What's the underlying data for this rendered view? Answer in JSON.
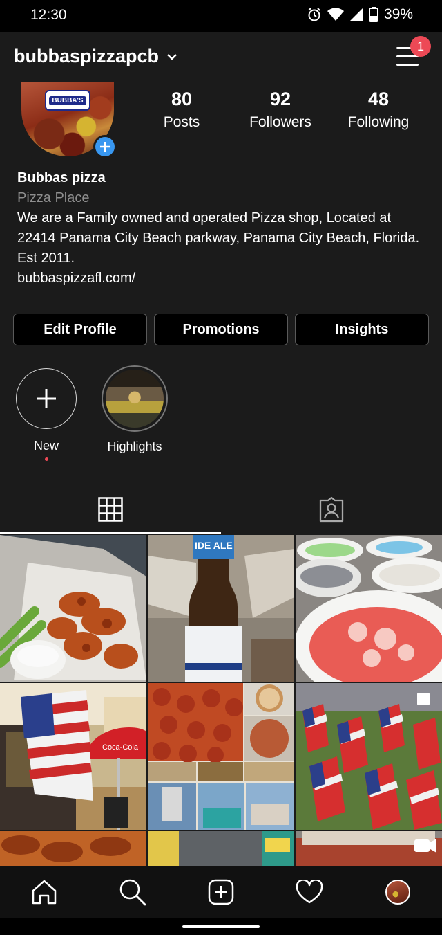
{
  "status_bar": {
    "time": "12:30",
    "battery": "39%"
  },
  "header": {
    "username": "bubbaspizzapcb",
    "notification_count": "1"
  },
  "profile": {
    "avatar_logo_text": "BUBBA'S",
    "stats": [
      {
        "value": "80",
        "label": "Posts"
      },
      {
        "value": "92",
        "label": "Followers"
      },
      {
        "value": "48",
        "label": "Following"
      }
    ],
    "bio": {
      "name": "Bubbas pizza",
      "category": "Pizza Place",
      "description": "We are a Family owned and operated Pizza shop, Located at 22414 Panama City Beach parkway, Panama City Beach, Florida. Est 2011.",
      "link": "bubbaspizzafl.com/"
    }
  },
  "buttons": {
    "edit_profile": "Edit Profile",
    "promotions": "Promotions",
    "insights": "Insights"
  },
  "stories": [
    {
      "label": "New",
      "icon": "plus-icon"
    },
    {
      "label": "Highlights"
    }
  ],
  "tabs": [
    {
      "icon": "grid-icon",
      "active": true
    },
    {
      "icon": "tagged-icon",
      "active": false
    }
  ],
  "posts": [
    {
      "subject": "buffalo wings with celery and ranch"
    },
    {
      "subject": "beer bottle in koozie",
      "label_text": "IDE ALE"
    },
    {
      "subject": "bowls of shaved ice"
    },
    {
      "subject": "storefront with american flag",
      "label_text": "Coca-Cola"
    },
    {
      "subject": "pizza collage"
    },
    {
      "subject": "field of american flags"
    },
    {
      "subject": "wings"
    },
    {
      "subject": "beer cans"
    },
    {
      "subject": "video post"
    }
  ],
  "bottom_nav": [
    {
      "icon": "home-icon"
    },
    {
      "icon": "search-icon"
    },
    {
      "icon": "new-post-icon"
    },
    {
      "icon": "heart-icon"
    },
    {
      "icon": "profile-avatar"
    }
  ]
}
